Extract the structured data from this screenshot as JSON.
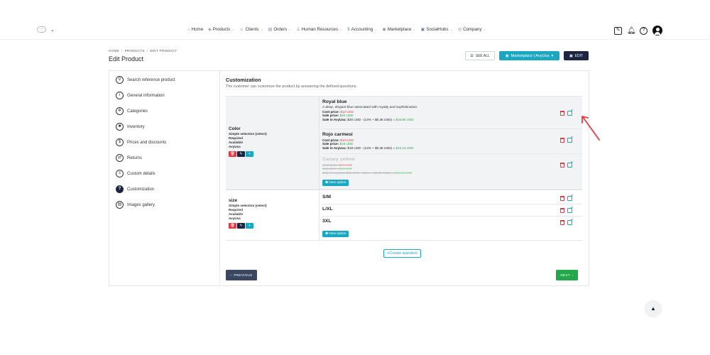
{
  "nav": {
    "items": [
      {
        "icon": "home-icon",
        "label": "Home"
      },
      {
        "icon": "cube-icon",
        "label": "Products"
      },
      {
        "icon": "users-icon",
        "label": "Clients"
      },
      {
        "icon": "orders-icon",
        "label": "Orders"
      },
      {
        "icon": "hr-icon",
        "label": "Human Resources"
      },
      {
        "icon": "dollar-icon",
        "label": "Accounting"
      },
      {
        "icon": "market-icon",
        "label": "Marketplace"
      },
      {
        "icon": "social-icon",
        "label": "SocialHubs"
      },
      {
        "icon": "company-icon",
        "label": "Company"
      }
    ]
  },
  "header": {
    "breadcrumb": [
      "HOME",
      "PRODUCTS",
      "EDIT PRODUCT"
    ],
    "title": "Edit Product",
    "see_all": "SEE ALL",
    "marketplace": "Marketplace | AvyUsa",
    "edit": "EDIT"
  },
  "sidebar": {
    "items": [
      {
        "icon": "search-icon",
        "label": "Search reference product"
      },
      {
        "icon": "info-icon",
        "label": "General information"
      },
      {
        "icon": "gear-icon",
        "label": "Categories"
      },
      {
        "icon": "inventory-icon",
        "label": "Inventory"
      },
      {
        "icon": "dollar-icon",
        "label": "Prices and discounts"
      },
      {
        "icon": "returns-icon",
        "label": "Returns"
      },
      {
        "icon": "list-icon",
        "label": "Custom details"
      },
      {
        "icon": "question-icon",
        "label": "Customization",
        "active": true
      },
      {
        "icon": "gallery-icon",
        "label": "Images gallery"
      }
    ]
  },
  "section": {
    "title": "Customization",
    "description": "The customer can customize the product by answering the defined questions."
  },
  "questions": [
    {
      "name": "Color",
      "type": "Simple selection (select)",
      "required": "Required",
      "status": "Available",
      "store": "AvyUsa",
      "options": [
        {
          "name": "Royal blue",
          "description": "A deep, elegant blue associated with royalty and sophistication.",
          "cost_label": "Cost price:",
          "cost": "$12 USD",
          "sale_label": "Sale price:",
          "sale": "$20 USD",
          "avy_label": "Sale in AvyUsa:",
          "avy_calc": "$20 USD - (14% + $0.35 USD) =",
          "avy_result": "$16.85 USD"
        },
        {
          "name": "Rojo carmesí",
          "cost_label": "Cost price:",
          "cost": "$10 USD",
          "sale_label": "Sale price:",
          "sale": "$18 USD",
          "avy_label": "Sale in AvyUsa:",
          "avy_calc": "$18 USD - (14% + $0.35 USD) =",
          "avy_result": "$15.13 USD"
        },
        {
          "name": "Canary yellow",
          "disabled": true,
          "cost_label": "Cost price:",
          "cost": "$10 USD",
          "sale_label": "Sale price:",
          "sale": "$18 USD",
          "avy_label": "Sale in AvyUsa:",
          "avy_calc": "$18 USD - (14% + $0.35 USD) =",
          "avy_result": "$15.13 USD"
        }
      ],
      "new_option": "New option"
    },
    {
      "name": "size",
      "type": "Simple selection (select)",
      "required": "Required",
      "status": "Available",
      "store": "AvyUsa",
      "options": [
        {
          "name": "S/M"
        },
        {
          "name": "L/XL"
        },
        {
          "name": "3XL"
        }
      ],
      "new_option": "New option"
    }
  ],
  "create_question": "Create question",
  "previous": "PREVIOUS",
  "next": "NEXT",
  "colors": {
    "accent": "#1aa7c1",
    "dark": "#1c2541",
    "danger": "#e53945",
    "success": "#22a84a"
  }
}
